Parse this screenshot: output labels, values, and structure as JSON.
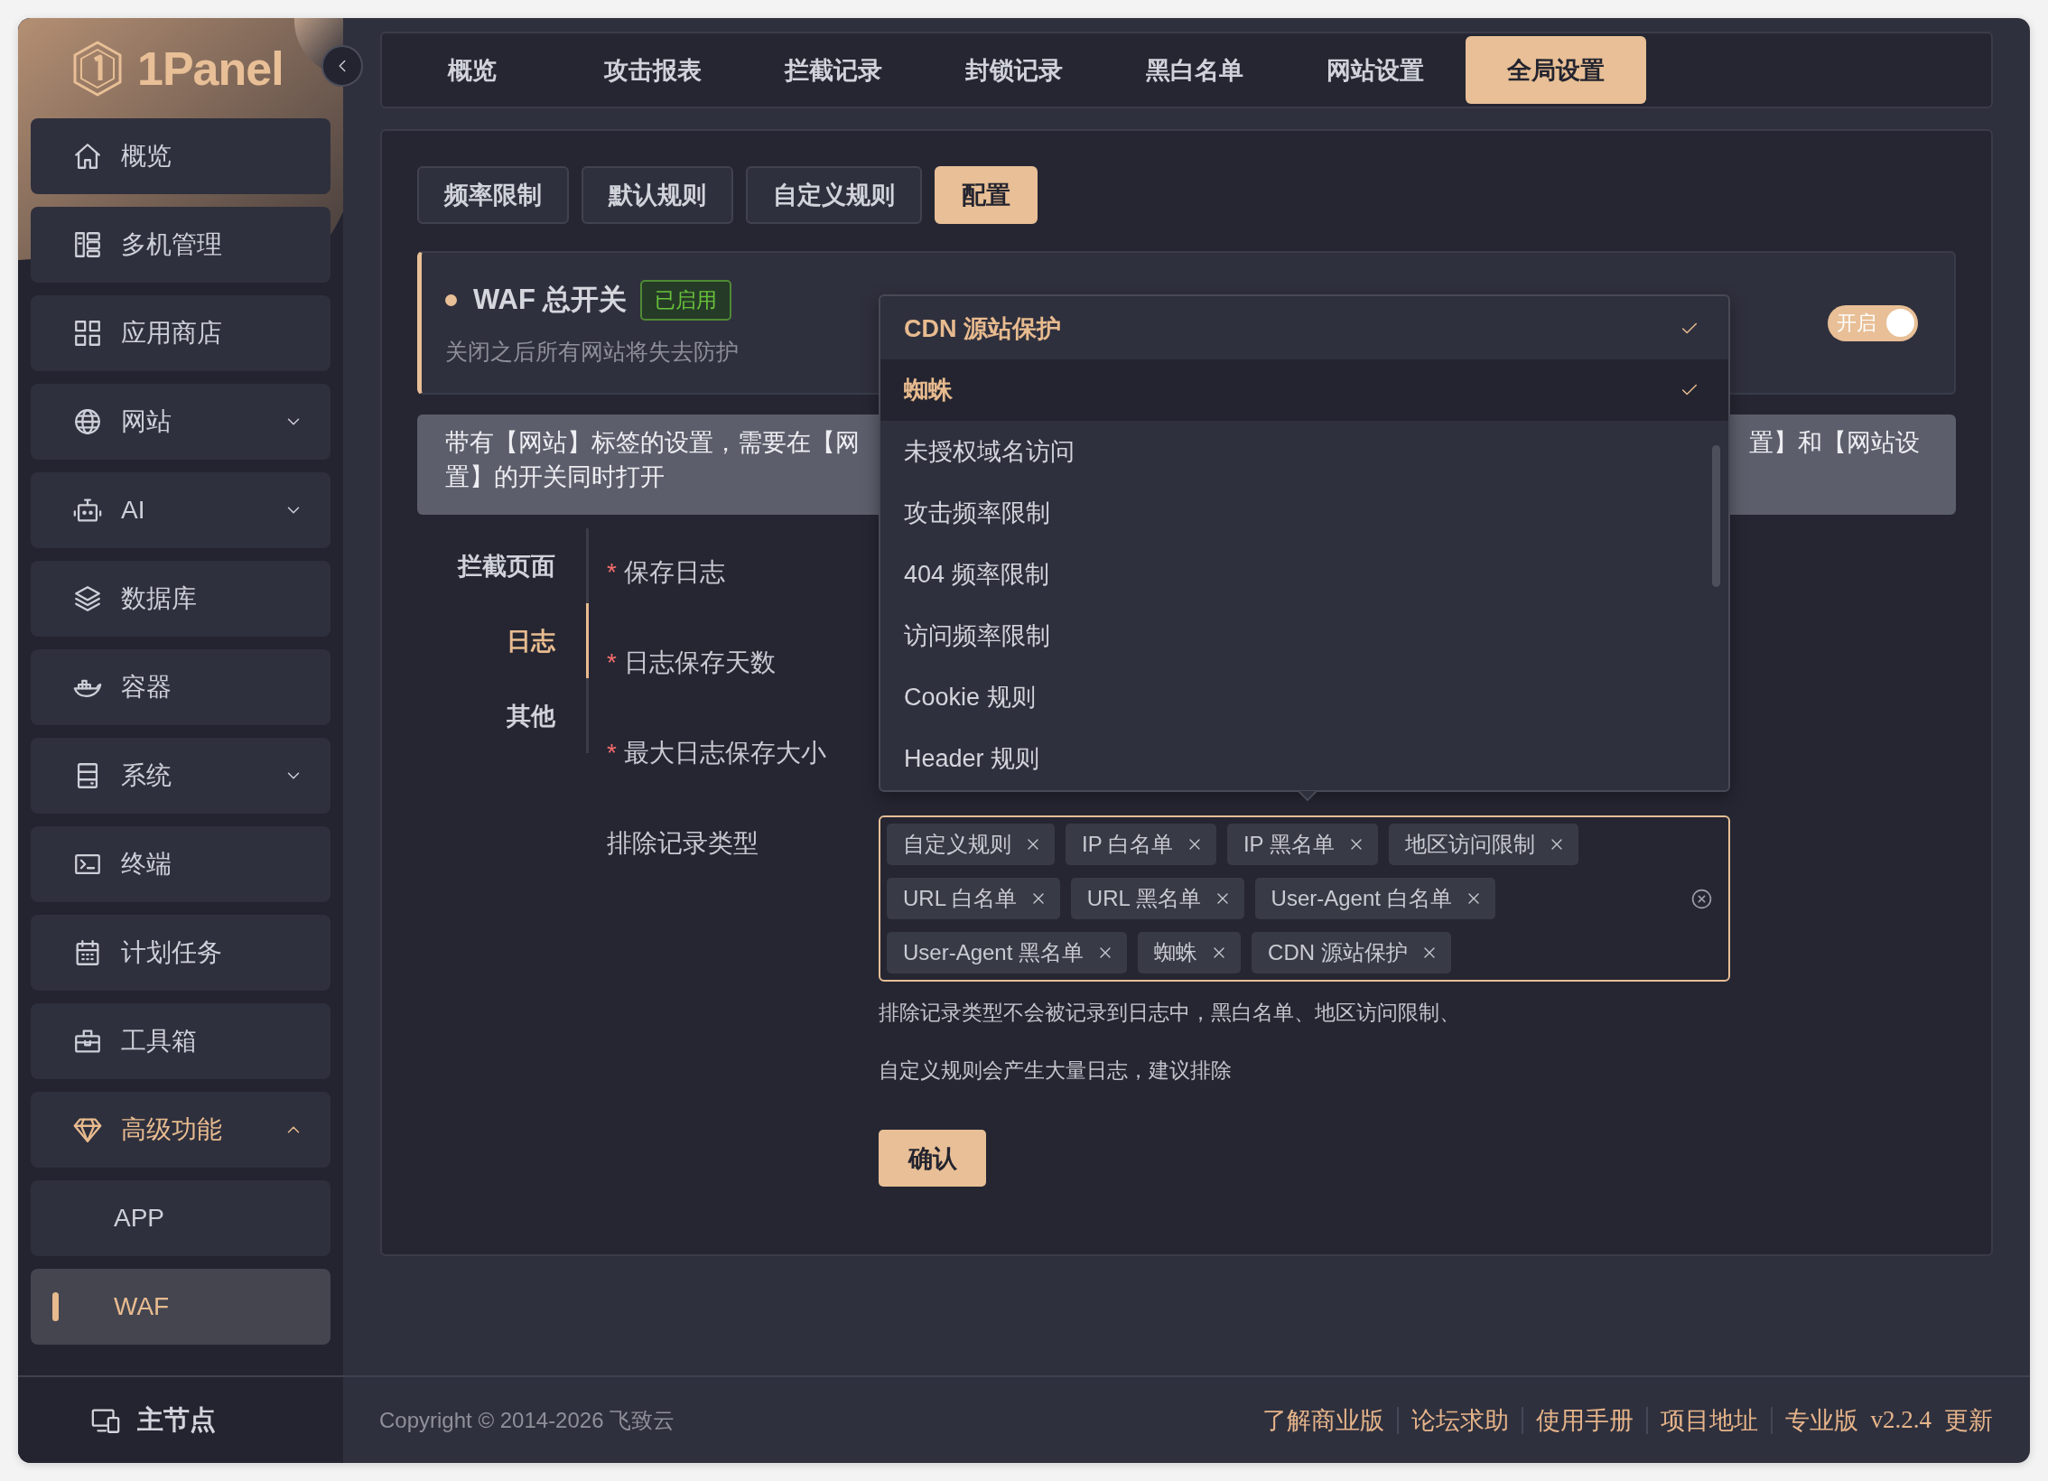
{
  "sidebar": {
    "logo": "1Panel",
    "items": [
      {
        "label": "概览",
        "selected": false
      },
      {
        "label": "多机管理",
        "selected": false
      },
      {
        "label": "应用商店",
        "selected": false
      },
      {
        "label": "网站",
        "selected": false,
        "expanded": false
      },
      {
        "label": "AI",
        "selected": false,
        "expanded": false
      },
      {
        "label": "数据库",
        "selected": false
      },
      {
        "label": "容器",
        "selected": false
      },
      {
        "label": "系统",
        "selected": false,
        "expanded": false
      },
      {
        "label": "终端",
        "selected": false
      },
      {
        "label": "计划任务",
        "selected": false
      },
      {
        "label": "工具箱",
        "selected": false
      },
      {
        "label": "高级功能",
        "expanded": true,
        "children": [
          {
            "label": "APP",
            "selected": false
          },
          {
            "label": "WAF",
            "selected": true
          }
        ]
      }
    ],
    "footer_item": "主节点"
  },
  "top_tabs": [
    {
      "label": "概览",
      "selected": false
    },
    {
      "label": "攻击报表",
      "selected": false
    },
    {
      "label": "拦截记录",
      "selected": false
    },
    {
      "label": "封锁记录",
      "selected": false
    },
    {
      "label": "黑白名单",
      "selected": false
    },
    {
      "label": "网站设置",
      "selected": false
    },
    {
      "label": "全局设置",
      "selected": true
    }
  ],
  "sub_tabs": [
    {
      "label": "频率限制",
      "selected": false
    },
    {
      "label": "默认规则",
      "selected": false
    },
    {
      "label": "自定义规则",
      "selected": false
    },
    {
      "label": "配置",
      "selected": true
    }
  ],
  "waf_switch": {
    "title": "WAF 总开关",
    "status_badge": "已启用",
    "description": "关闭之后所有网站将失去防护",
    "toggle": {
      "label": "开启",
      "on": true
    }
  },
  "alert": {
    "line_1_start": "带有【网站】标签的设置，需要在【网",
    "line_1_end": "置】和【网站设",
    "line_2": "置】的开关同时打开"
  },
  "anchor_nav": [
    {
      "label": "拦截页面",
      "selected": false
    },
    {
      "label": "日志",
      "selected": true
    },
    {
      "label": "其他",
      "selected": false
    }
  ],
  "form": {
    "required_mark": "*",
    "fields": [
      {
        "label": "保存日志",
        "required": true
      },
      {
        "label": "日志保存天数",
        "required": true
      },
      {
        "label": "最大日志保存大小",
        "required": true
      }
    ],
    "exclude": {
      "label": "排除记录类型",
      "tags": [
        "自定义规则",
        "IP 白名单",
        "IP 黑名单",
        "地区访问限制",
        "URL 白名单",
        "URL 黑名单",
        "User-Agent 白名单",
        "User-Agent 黑名单",
        "蜘蛛",
        "CDN 源站保护"
      ],
      "hints": [
        "排除记录类型不会被记录到日志中，黑白名单、地区访问限制、",
        "自定义规则会产生大量日志，建议排除"
      ]
    },
    "confirm_button": "确认"
  },
  "dropdown": {
    "options": [
      {
        "label": "CDN 源站保护",
        "selected": true,
        "highlighted": false
      },
      {
        "label": "蜘蛛",
        "selected": true,
        "highlighted": true
      },
      {
        "label": "未授权域名访问",
        "selected": false,
        "highlighted": false
      },
      {
        "label": "攻击频率限制",
        "selected": false,
        "highlighted": false
      },
      {
        "label": "404 频率限制",
        "selected": false,
        "highlighted": false
      },
      {
        "label": "访问频率限制",
        "selected": false,
        "highlighted": false
      },
      {
        "label": "Cookie 规则",
        "selected": false,
        "highlighted": false
      },
      {
        "label": "Header 规则",
        "selected": false,
        "highlighted": false
      }
    ]
  },
  "footer": {
    "copyright": "Copyright © 2014-2026 飞致云",
    "links": [
      "了解商业版",
      "论坛求助",
      "使用手册",
      "项目地址",
      "专业版"
    ],
    "version": "v2.2.4",
    "update": "更新"
  }
}
